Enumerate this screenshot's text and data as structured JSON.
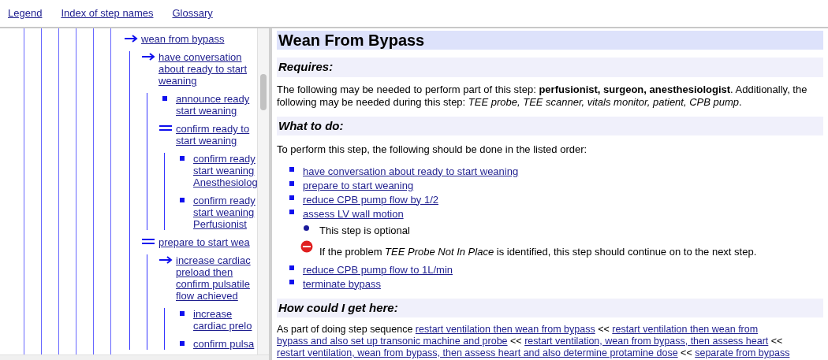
{
  "nav_links": [
    "Legend",
    "Index of step names",
    "Glossary"
  ],
  "tree": [
    {
      "kind": "arrow",
      "lines": [
        "wean from bypass"
      ],
      "children": [
        {
          "kind": "arrow",
          "lines": [
            "have conversation",
            "about ready to start",
            "weaning"
          ],
          "children": [
            {
              "kind": "square",
              "lines": [
                "announce ready",
                "start weaning"
              ]
            },
            {
              "kind": "equals",
              "lines": [
                "confirm ready to",
                "start weaning"
              ],
              "children": [
                {
                  "kind": "square",
                  "lines": [
                    "confirm ready",
                    "start weaning",
                    "Anesthesiolog"
                  ]
                },
                {
                  "kind": "square",
                  "lines": [
                    "confirm ready",
                    "start weaning",
                    "Perfusionist"
                  ]
                }
              ]
            }
          ]
        },
        {
          "kind": "equals",
          "lines": [
            "prepare to start wea"
          ],
          "children": [
            {
              "kind": "arrow",
              "lines": [
                "increase cardiac",
                "preload then",
                "confirm pulsatile",
                "flow achieved"
              ],
              "children": [
                {
                  "kind": "square",
                  "lines": [
                    "increase",
                    "cardiac prelo"
                  ]
                },
                {
                  "kind": "square",
                  "lines": [
                    "confirm pulsa"
                  ]
                }
              ]
            }
          ]
        }
      ]
    }
  ],
  "step": {
    "title": "Wean From Bypass",
    "requires": {
      "heading": "Requires:",
      "text": "The following may be needed to perform part of this step: **perfusionist, surgeon, anesthesiologist**. Additionally, the following may be needed during this step: *TEE probe, TEE scanner, vitals monitor, patient, CPB pump*."
    },
    "what_to_do": {
      "heading": "What to do:",
      "intro": "To perform this step, the following should be done in the listed order:",
      "steps": [
        {
          "label": "have conversation about ready to start weaning"
        },
        {
          "label": "prepare to start weaning"
        },
        {
          "label": "reduce CPB pump flow by 1/2"
        },
        {
          "label": "assess LV wall motion",
          "notes": [
            {
              "kind": "optional",
              "text": "This step is optional"
            },
            {
              "kind": "problem",
              "text": "If the problem *TEE Probe Not In Place* is identified, this step should continue on to the next step."
            }
          ]
        },
        {
          "label": "reduce CPB pump flow to 1L/min"
        },
        {
          "label": "terminate bypass"
        }
      ]
    },
    "how_here": {
      "heading": "How could I get here:",
      "lines": [
        [
          {
            "kind": "text",
            "text": "As part of doing step sequence"
          },
          {
            "kind": "link",
            "text": "restart ventilation then wean from bypass"
          },
          {
            "kind": "text",
            "text": "<<"
          },
          {
            "kind": "link",
            "text": "restart ventilation then wean from"
          }
        ],
        [
          {
            "kind": "link",
            "text": "bypass and also set up transonic machine and probe"
          },
          {
            "kind": "text",
            "text": "<<"
          },
          {
            "kind": "link",
            "text": "restart ventilation, wean from bypass, then assess heart"
          },
          {
            "kind": "text",
            "text": "<<"
          }
        ],
        [
          {
            "kind": "link",
            "text": "restart ventilation, wean from bypass, then assess heart and also determine protamine dose"
          },
          {
            "kind": "text",
            "text": "<<"
          },
          {
            "kind": "link",
            "text": "separate from bypass"
          }
        ]
      ]
    }
  }
}
